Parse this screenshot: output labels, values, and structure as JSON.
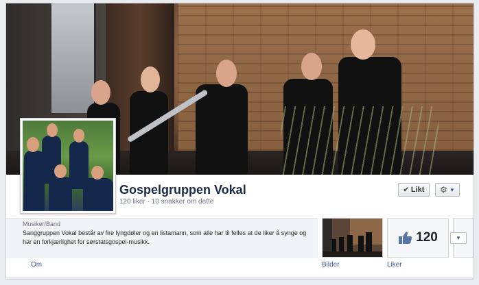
{
  "page": {
    "name": "Gospelgruppen Vokal",
    "stats": "120 liker · 10 snakker om dette"
  },
  "buttons": {
    "like_label": "Likt",
    "like_icon": "checkmark-icon",
    "gear_icon": "gear-icon",
    "more_icon": "chevron-down-icon"
  },
  "about": {
    "category": "Musiker/Band",
    "text": "Sanggruppen Vokal består av fire lyngdøler og en listamann, som alle har til felles at de liker å synge og har en forkjærlighet for sørstatsgospel-musikk."
  },
  "tiles": {
    "likes_count": "120",
    "likes_icon": "thumbs-up-icon"
  },
  "tabs": {
    "about": "Om",
    "photos": "Bilder",
    "likes": "Liker"
  },
  "colors": {
    "title": "#1c2a47",
    "link": "#3b5998",
    "background": "#e9ebee"
  }
}
